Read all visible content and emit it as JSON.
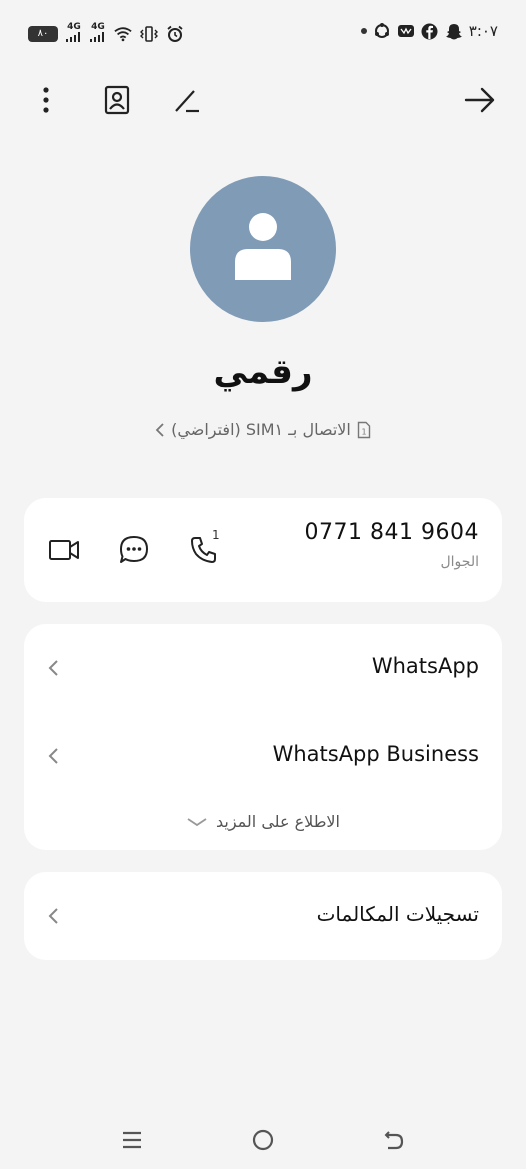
{
  "status_bar": {
    "battery": "٨٠",
    "signal1": "4G",
    "signal2": "4G",
    "time": "٣:٠٧"
  },
  "contact": {
    "name": "رقمي",
    "sim_text": "الاتصال بـ SIM١ (افتراضي)"
  },
  "phone": {
    "number": "0771 841 9604",
    "label": "الجوال",
    "sim_badge": "1"
  },
  "apps": {
    "items": [
      {
        "label": "WhatsApp"
      },
      {
        "label": "WhatsApp Business"
      }
    ],
    "more_label": "الاطلاع على المزيد"
  },
  "call_log": {
    "label": "تسجيلات المكالمات"
  }
}
